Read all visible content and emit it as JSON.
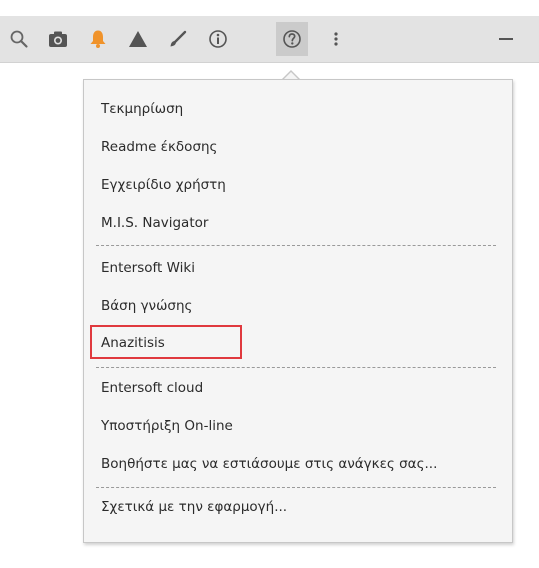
{
  "toolbar": {
    "buttons": [
      {
        "icon": "search-icon"
      },
      {
        "icon": "camera-icon"
      },
      {
        "icon": "bell-icon",
        "color": "#f0932b"
      },
      {
        "icon": "triangle-icon"
      },
      {
        "icon": "brush-icon"
      },
      {
        "icon": "info-icon"
      },
      {
        "icon": "help-icon",
        "active": true
      },
      {
        "icon": "more-vertical-icon"
      },
      {
        "icon": "minimize-icon"
      }
    ]
  },
  "help_menu": {
    "groups": [
      [
        "Τεκμηρίωση",
        "Readme έκδοσης",
        "Εγχειρίδιο χρήστη",
        "M.I.S. Navigator"
      ],
      [
        "Entersoft Wiki",
        "Βάση γνώσης",
        "Anazitisis"
      ],
      [
        "Entersoft cloud",
        "Υποστήριξη On-line",
        "Βοηθήστε μας να εστιάσουμε στις ανάγκες σας..."
      ],
      [
        "Σχετικά με την εφαρμογή..."
      ]
    ],
    "highlighted_item": "Anazitisis",
    "highlight_color": "#e0393e"
  }
}
